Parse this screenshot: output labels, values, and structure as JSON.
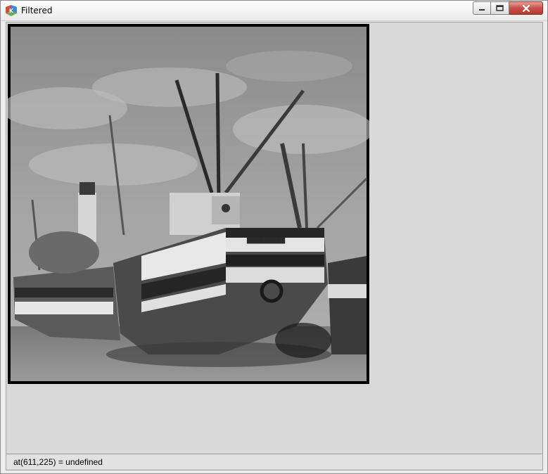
{
  "window": {
    "title": "Filtered",
    "app_icon": "gtk-logo-icon",
    "controls": {
      "minimize": "minimize-icon",
      "maximize": "maximize-icon",
      "close": "close-icon"
    }
  },
  "image": {
    "description_icon": "filtered-boat-image"
  },
  "status": {
    "text": "at(611,225) = undefined"
  },
  "colors": {
    "client_bg": "#d9d9d9",
    "close_red": "#c75050"
  }
}
